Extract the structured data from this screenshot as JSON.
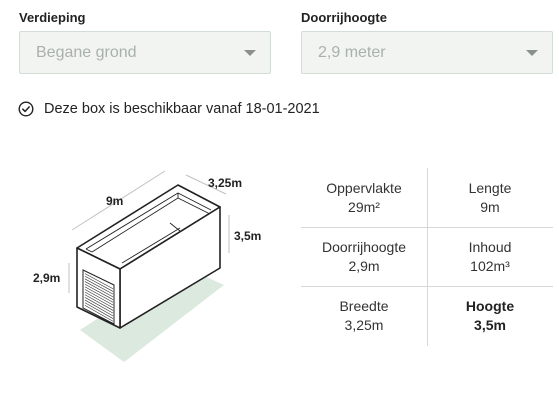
{
  "filters": {
    "floor": {
      "label": "Verdieping",
      "value": "Begane grond"
    },
    "clearance": {
      "label": "Doorrijhoogte",
      "value": "2,9 meter"
    }
  },
  "availability": {
    "text": "Deze box is beschikbaar vanaf 18-01-2021",
    "icon": "check-circle-icon"
  },
  "illustration": {
    "length": "9m",
    "width": "3,25m",
    "height": "3,5m",
    "door_height": "2,9m",
    "floor_color": "#dbe9df"
  },
  "specs": [
    {
      "label": "Oppervlakte",
      "value": "29m²",
      "bold": false
    },
    {
      "label": "Lengte",
      "value": "9m",
      "bold": false
    },
    {
      "label": "Doorrijhoogte",
      "value": "2,9m",
      "bold": false
    },
    {
      "label": "Inhoud",
      "value": "102m³",
      "bold": false
    },
    {
      "label": "Breedte",
      "value": "3,25m",
      "bold": false
    },
    {
      "label": "Hoogte",
      "value": "3,5m",
      "bold": true
    }
  ]
}
